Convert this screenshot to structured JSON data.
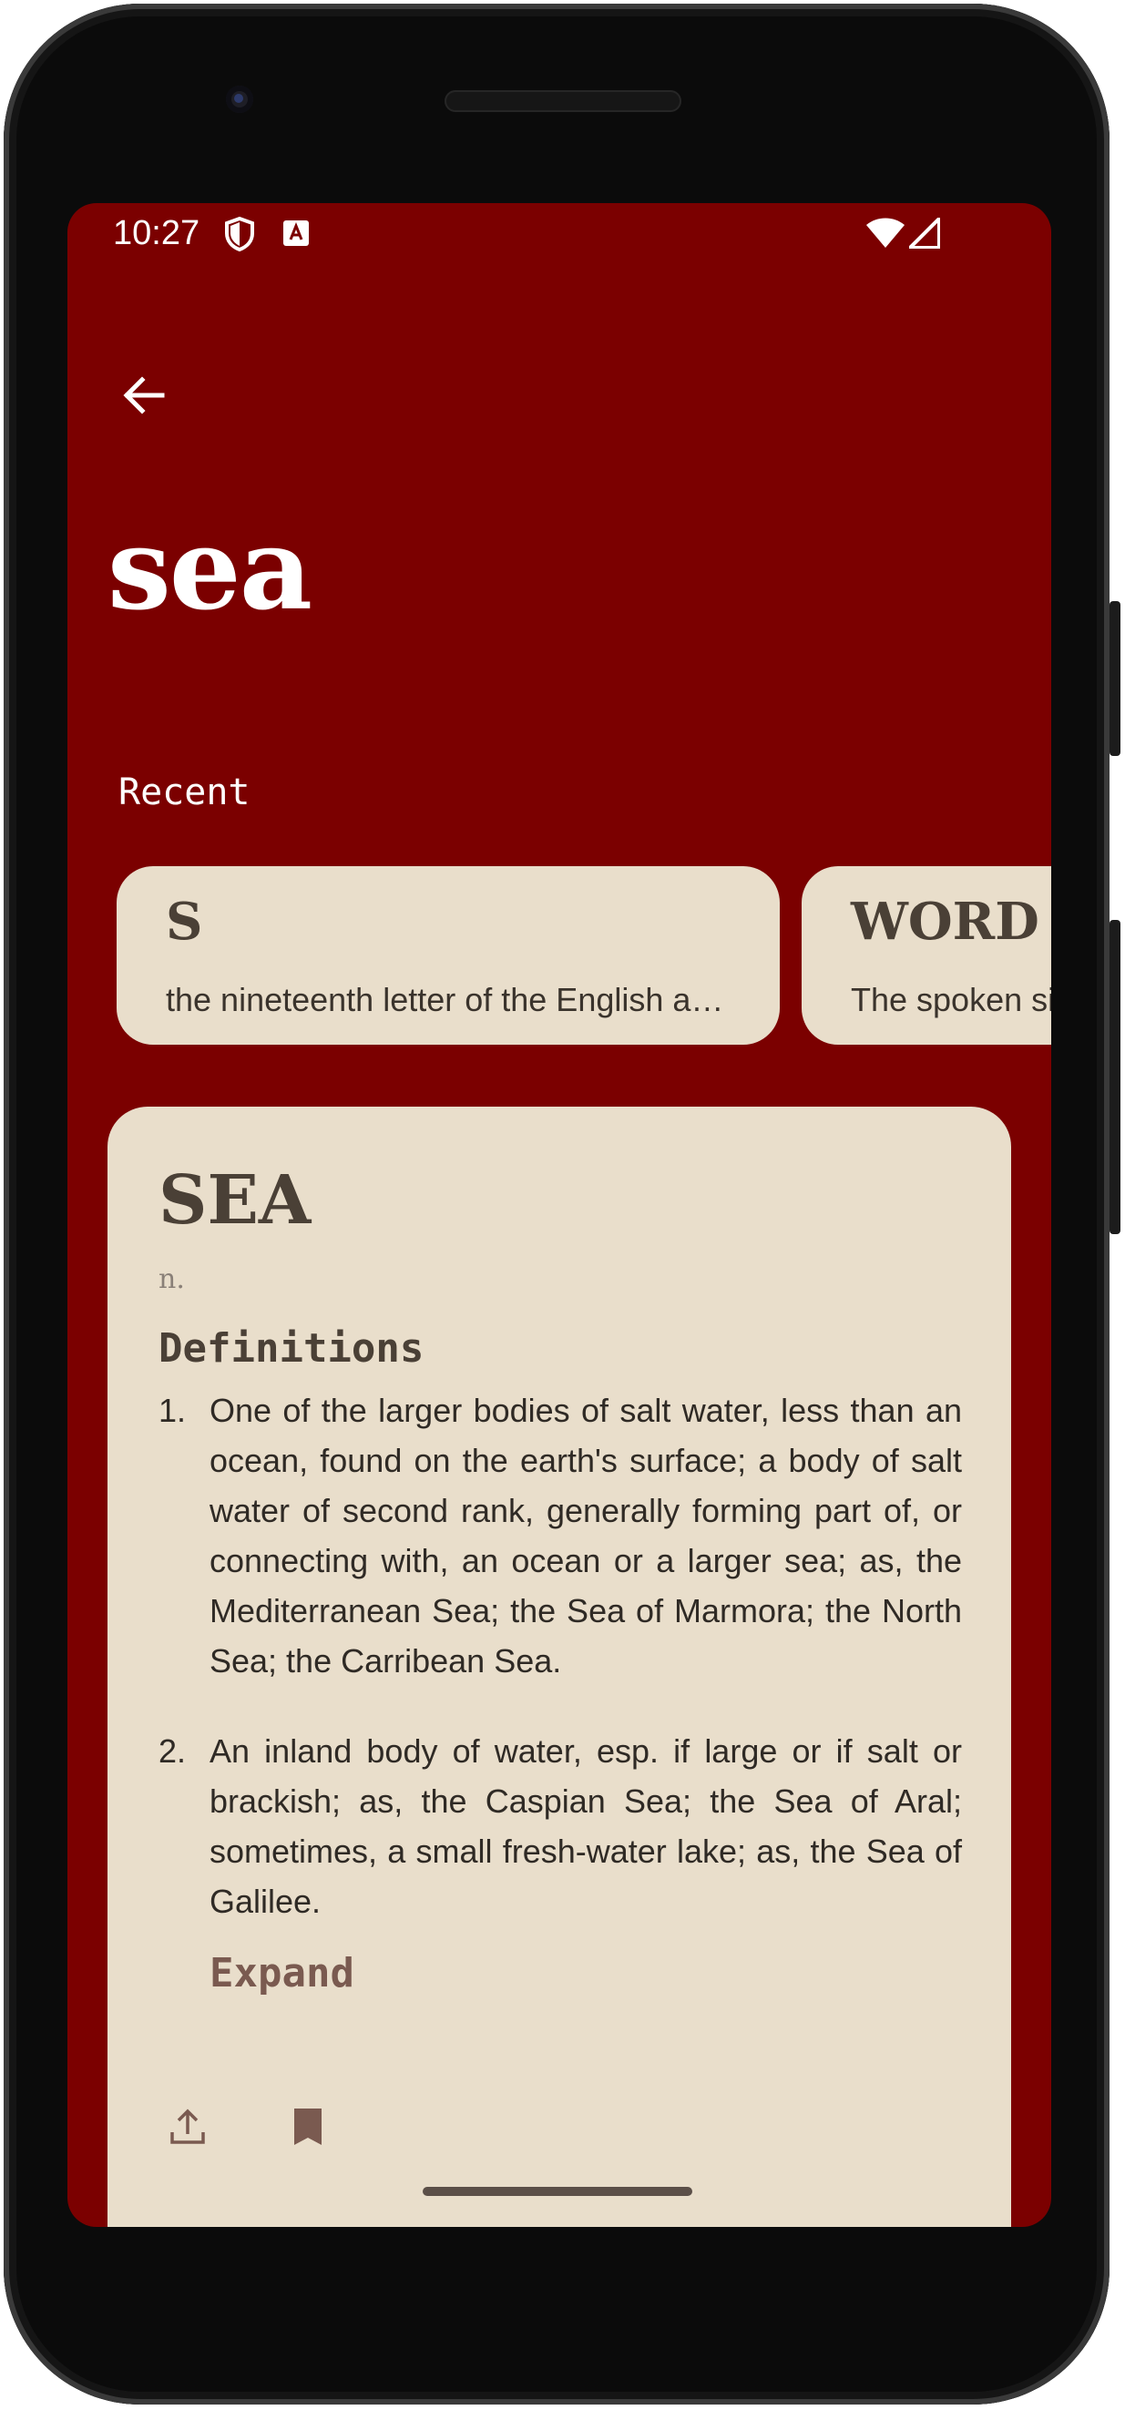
{
  "status_bar": {
    "time": "10:27",
    "icons": [
      "shield-icon",
      "a11y-icon",
      "wifi-icon",
      "signal-icon"
    ]
  },
  "header": {
    "back_icon": "arrow-left-icon",
    "word": "sea"
  },
  "recent": {
    "label": "Recent",
    "items": [
      {
        "word": "S",
        "definition": "the nineteenth letter of the English alphabet"
      },
      {
        "word": "WORD",
        "definition": "The spoken sign of a conception or an idea"
      }
    ]
  },
  "entry": {
    "word": "SEA",
    "part_of_speech": "n.",
    "definitions_heading": "Definitions",
    "definitions": [
      {
        "num": "1.",
        "text": "One of the larger bodies of salt water, less than an ocean, found on the earth's surface; a body of salt water of second rank, generally forming part of, or connecting with, an ocean or a larger sea; as, the Mediterranean Sea; the Sea of Marmora; the North Sea; the Carribean Sea."
      },
      {
        "num": "2.",
        "text": "An inland body of water, esp. if large or if salt or brackish; as, the Caspian Sea; the Sea of Aral; sometimes, a small fresh-water lake; as, the Sea of Galilee."
      }
    ],
    "expand_label": "Expand",
    "actions": [
      "share-icon",
      "bookmark-icon"
    ]
  },
  "colors": {
    "background": "#7b0000",
    "card": "#e9decb",
    "card_text": "#4a4036",
    "accent": "#7a5a50"
  }
}
